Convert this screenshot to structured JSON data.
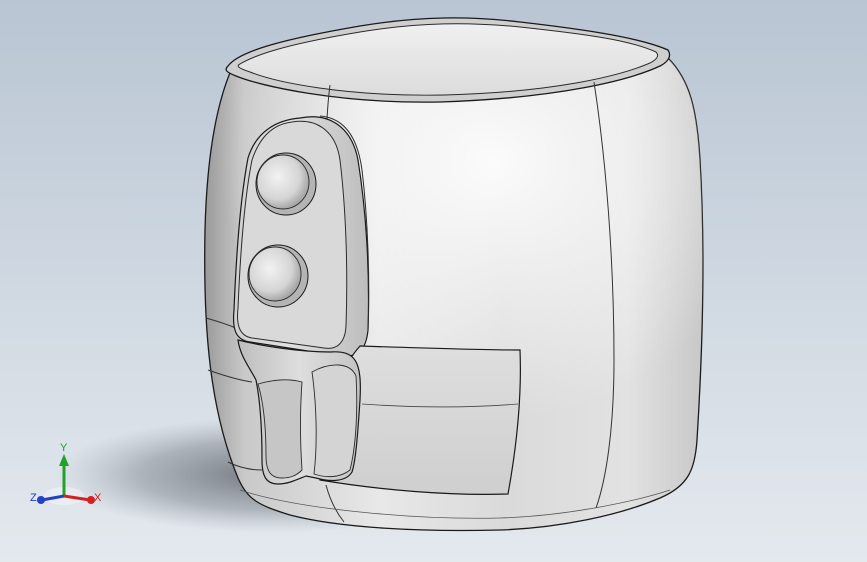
{
  "viewport": {
    "background_top": "#b9c5d3",
    "background_bottom": "#e4e9ee"
  },
  "model": {
    "description_type": "air-fryer-3d-model",
    "body_color": "#d8d8d8",
    "edge_color": "#1a1a1a"
  },
  "triad": {
    "x_label": "X",
    "y_label": "Y",
    "z_label": "Z",
    "x_color": "#d42020",
    "y_color": "#1fa12b",
    "z_color": "#2440c8"
  }
}
